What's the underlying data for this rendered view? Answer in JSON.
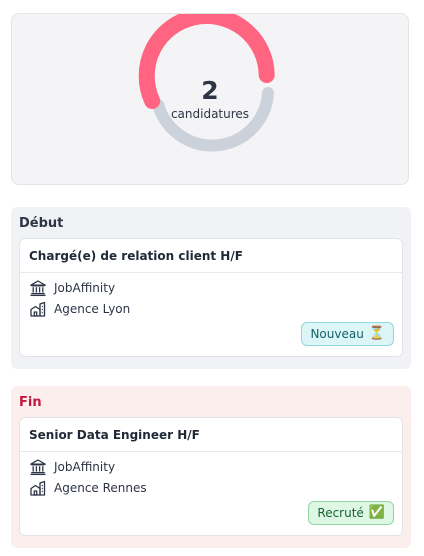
{
  "summary": {
    "count": "2",
    "label": "candidatures",
    "ring_fraction_highlight": 0.5,
    "highlight_color": "#ff6480",
    "base_color": "#ccd2db"
  },
  "sections": [
    {
      "title": "Début",
      "card": {
        "job_title": "Chargé(e) de relation client H/F",
        "company": "JobAffinity",
        "agency": "Agence Lyon",
        "company_icon": "bank-icon",
        "agency_icon": "building-icon",
        "status_label": "Nouveau",
        "status_emoji": "⏳"
      }
    },
    {
      "title": "Fin",
      "card": {
        "job_title": "Senior Data Engineer H/F",
        "company": "JobAffinity",
        "agency": "Agence Rennes",
        "company_icon": "bank-icon",
        "agency_icon": "building-icon",
        "status_label": "Recruté",
        "status_emoji": "✅"
      }
    }
  ]
}
